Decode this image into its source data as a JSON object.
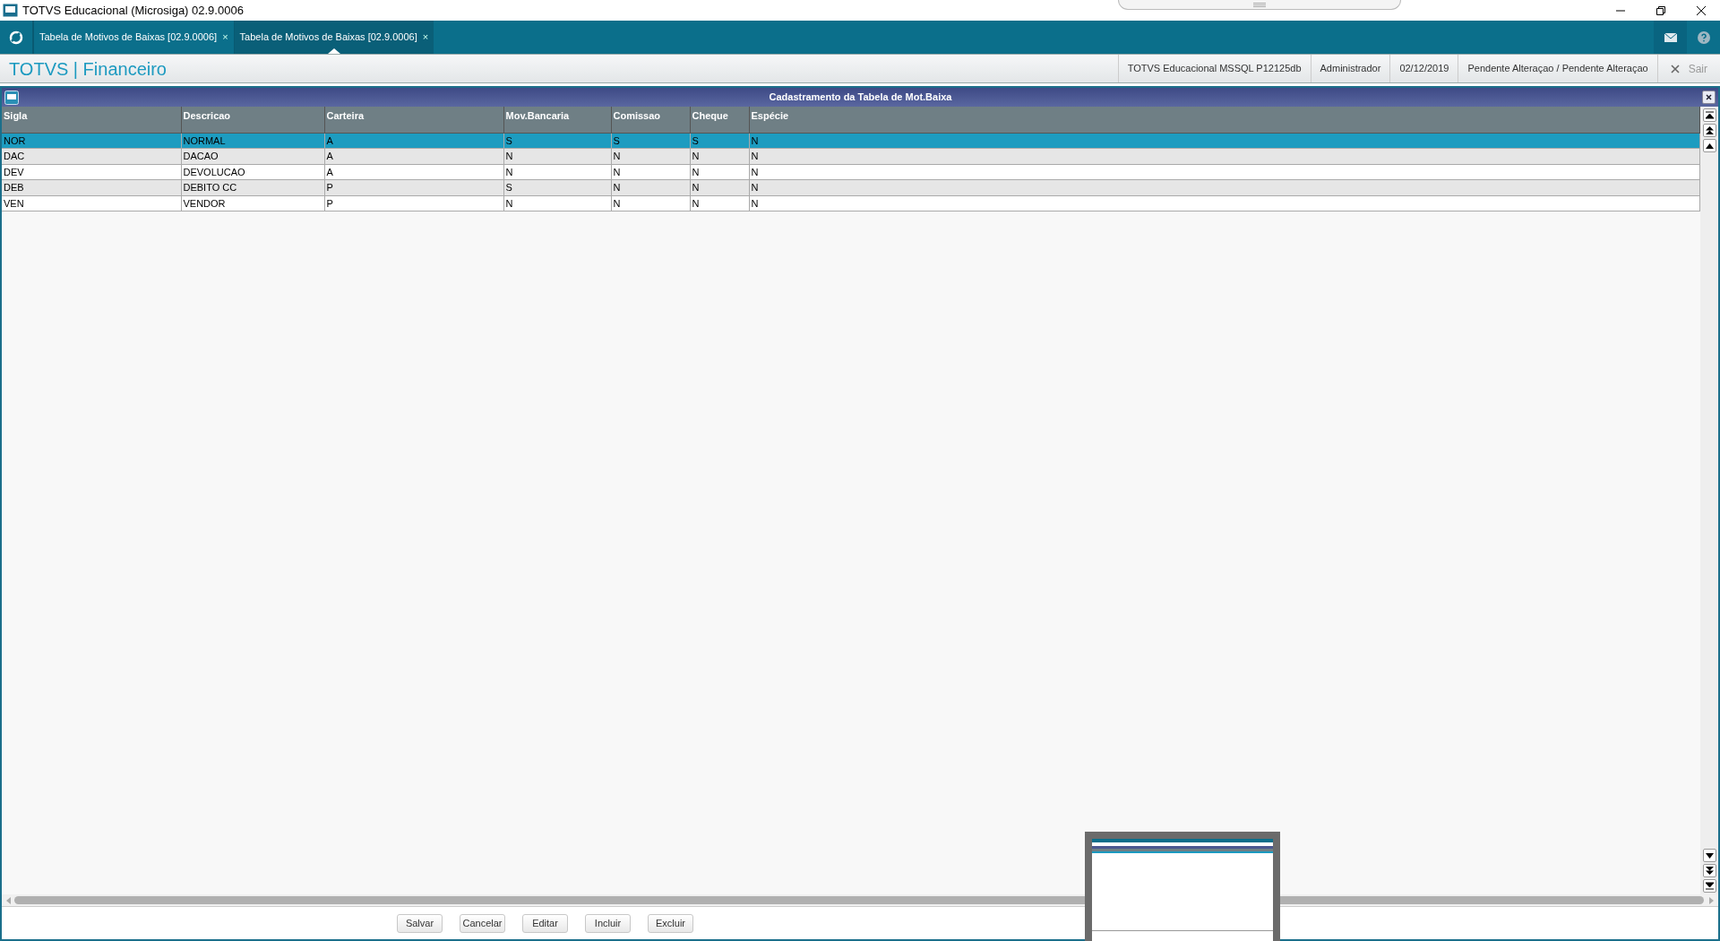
{
  "window": {
    "title": "TOTVS Educacional (Microsiga) 02.9.0006"
  },
  "tabs": [
    {
      "label": "Tabela de Motivos de Baixas [02.9.0006]",
      "close": "×",
      "selected": false
    },
    {
      "label": "Tabela de Motivos de Baixas [02.9.0006]",
      "close": "×",
      "selected": true
    }
  ],
  "header": {
    "brand": "TOTVS",
    "separator": "|",
    "module": "Financeiro",
    "info": [
      "TOTVS Educacional MSSQL P12125db",
      "Administrador",
      "02/12/2019",
      "Pendente Alteraçao / Pendente Alteraçao"
    ],
    "exit": "Sair"
  },
  "panel": {
    "title": "Cadastramento da Tabela de Mot.Baixa"
  },
  "table": {
    "columns": [
      "Sigla",
      "Descricao",
      "Carteira",
      "Mov.Bancaria",
      "Comissao",
      "Cheque",
      "Espécie"
    ],
    "rows": [
      {
        "cells": [
          "NOR",
          "NORMAL",
          "A",
          "S",
          "S",
          "S",
          "N"
        ],
        "selected": true
      },
      {
        "cells": [
          "DAC",
          "DACAO",
          "A",
          "N",
          "N",
          "N",
          "N"
        ],
        "selected": false
      },
      {
        "cells": [
          "DEV",
          "DEVOLUCAO",
          "A",
          "N",
          "N",
          "N",
          "N"
        ],
        "selected": false
      },
      {
        "cells": [
          "DEB",
          "DEBITO CC",
          "P",
          "S",
          "N",
          "N",
          "N"
        ],
        "selected": false
      },
      {
        "cells": [
          "VEN",
          "VENDOR",
          "P",
          "N",
          "N",
          "N",
          "N"
        ],
        "selected": false
      }
    ]
  },
  "buttons": [
    "Salvar",
    "Cancelar",
    "Editar",
    "Incluir",
    "Excluir"
  ]
}
